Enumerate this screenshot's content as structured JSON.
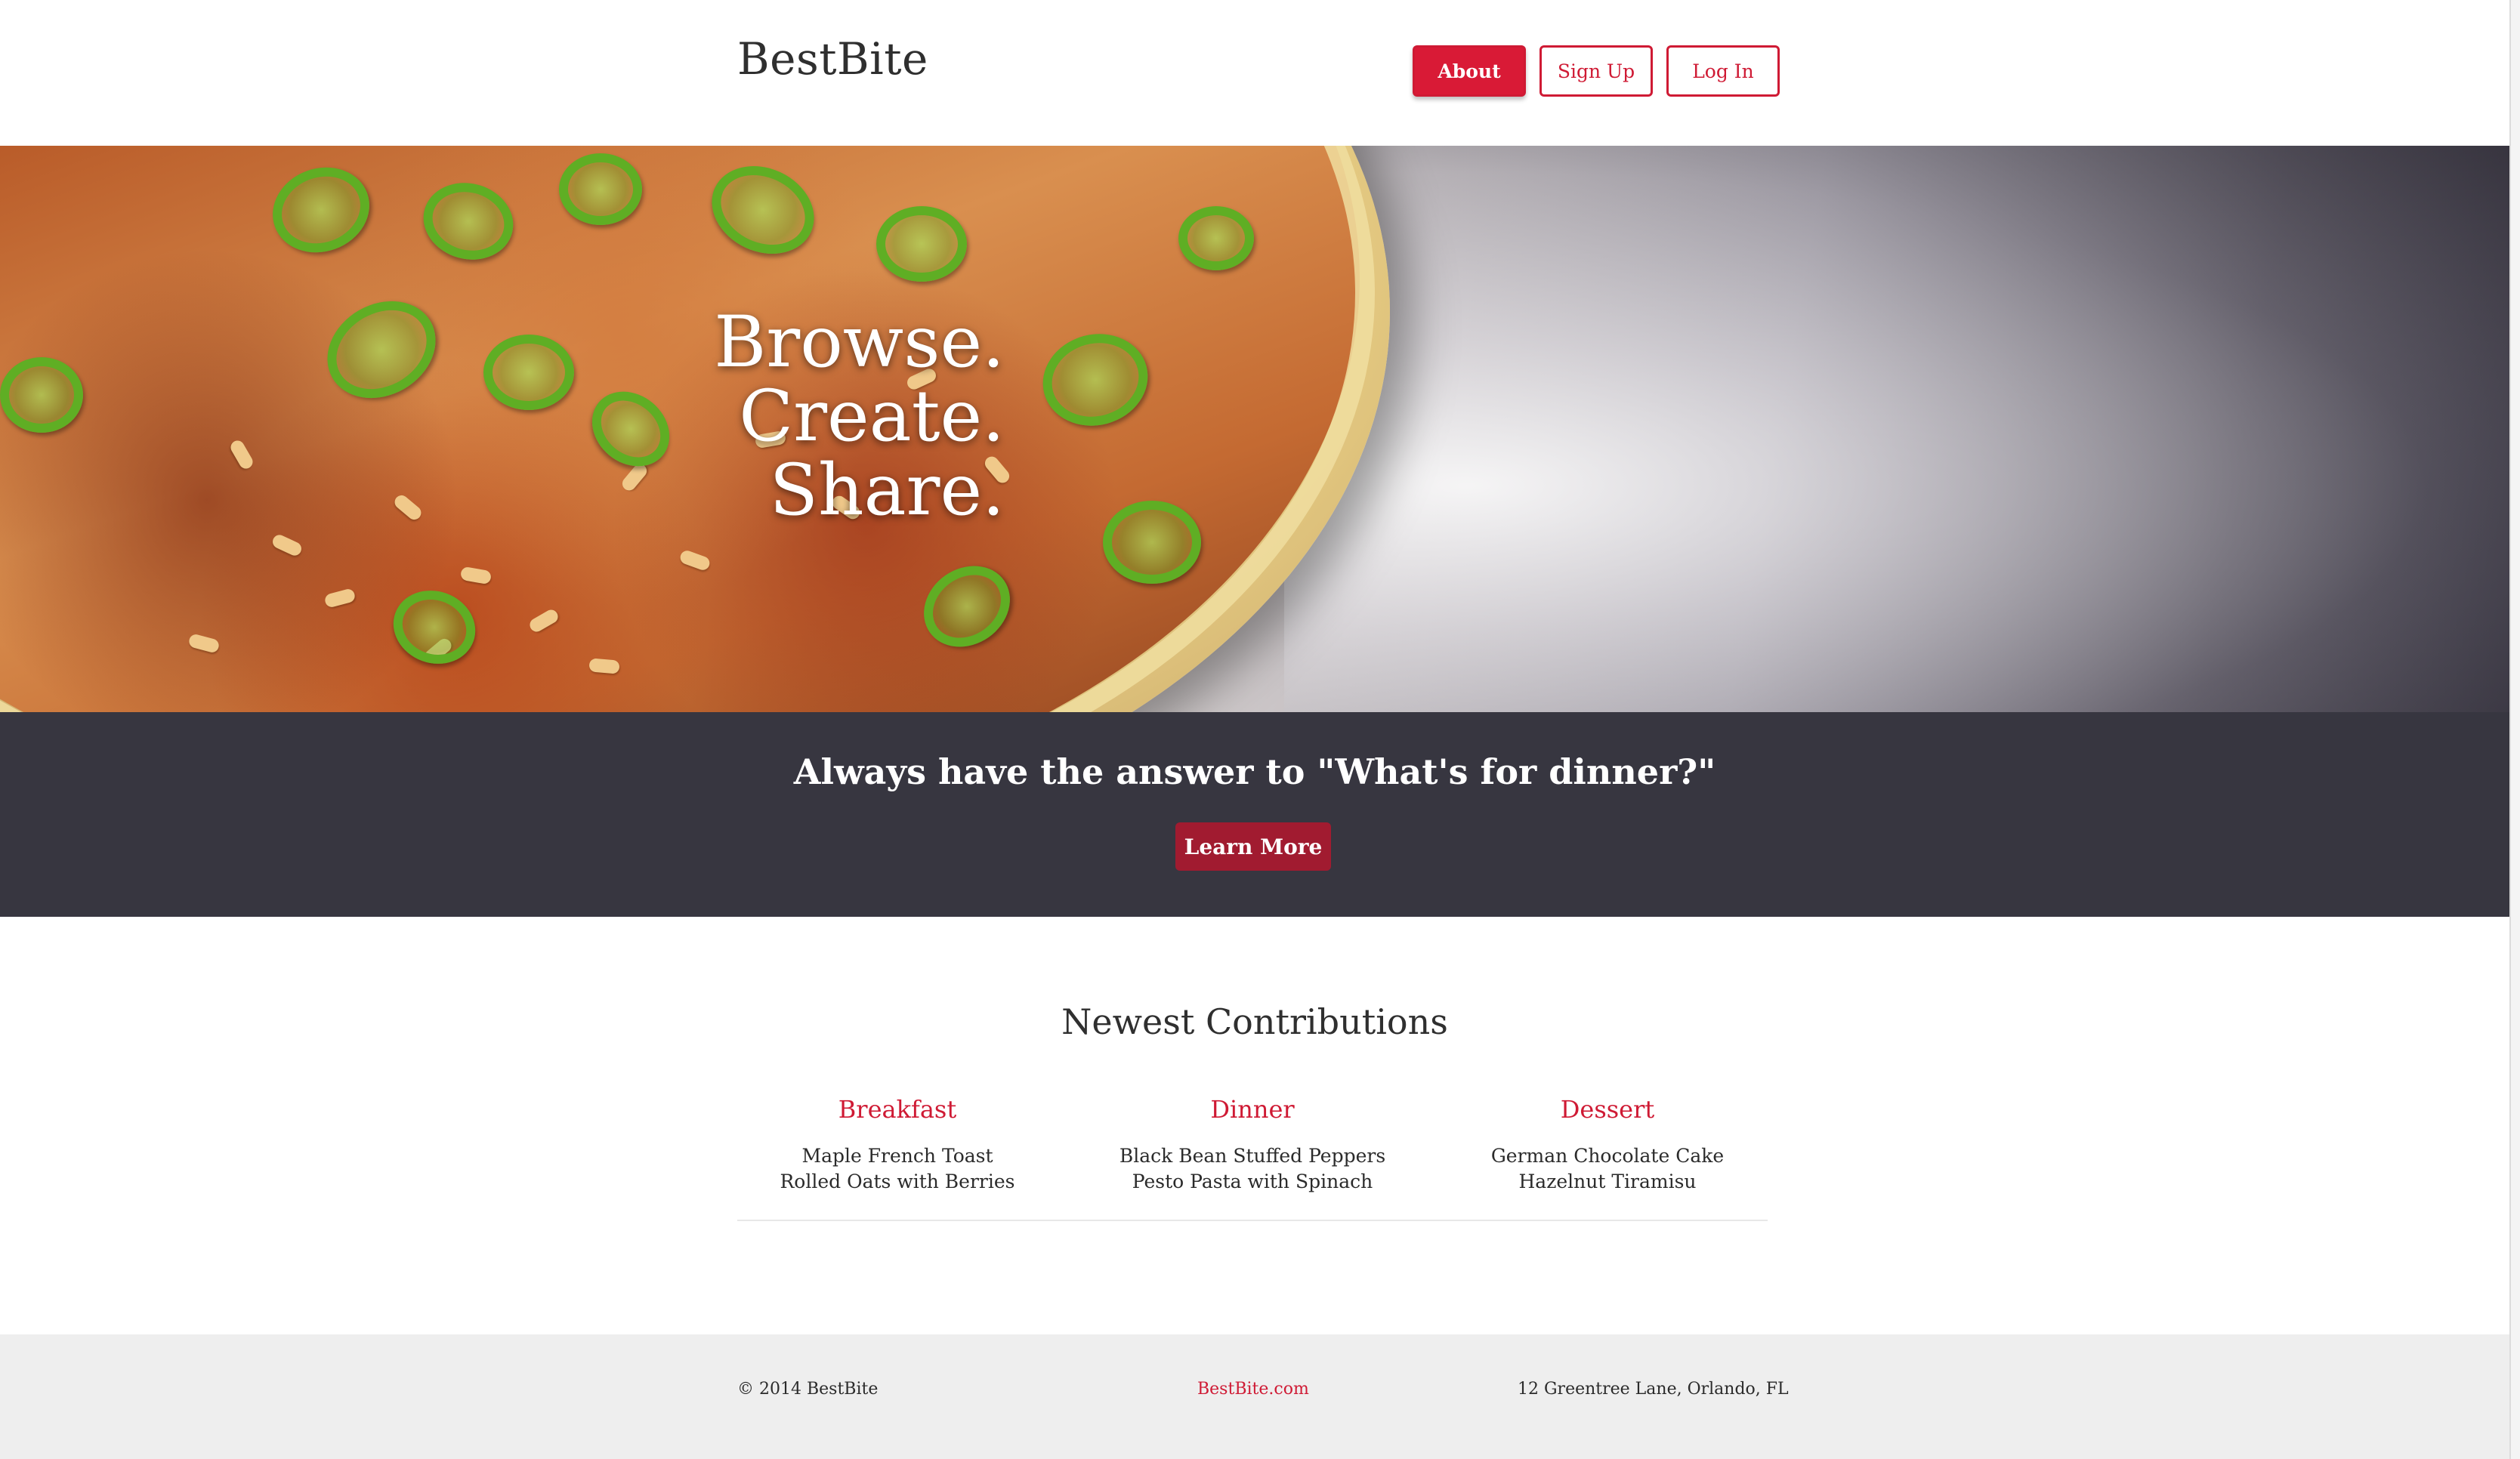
{
  "header": {
    "brand": "BestBite",
    "nav": {
      "about": "About",
      "signup": "Sign Up",
      "login": "Log In"
    }
  },
  "hero": {
    "lines": [
      "Browse.",
      "Create.",
      "Share."
    ]
  },
  "cta": {
    "title": "Always have the answer to \"What's for dinner?\"",
    "button": "Learn More"
  },
  "contributions": {
    "title": "Newest Contributions",
    "columns": [
      {
        "heading": "Breakfast",
        "items": [
          "Maple French Toast",
          "Rolled Oats with Berries"
        ]
      },
      {
        "heading": "Dinner",
        "items": [
          "Black Bean Stuffed Peppers",
          "Pesto Pasta with Spinach"
        ]
      },
      {
        "heading": "Dessert",
        "items": [
          "German Chocolate Cake",
          "Hazelnut Tiramisu"
        ]
      }
    ]
  },
  "footer": {
    "copyright": "© 2014 BestBite",
    "site_link": "BestBite.com",
    "address": "12 Greentree Lane, Orlando, FL"
  },
  "colors": {
    "accent": "#cf1a34",
    "cta_band": "#373640",
    "cta_button": "#a11b30",
    "footer_bg": "#eeeeee"
  }
}
